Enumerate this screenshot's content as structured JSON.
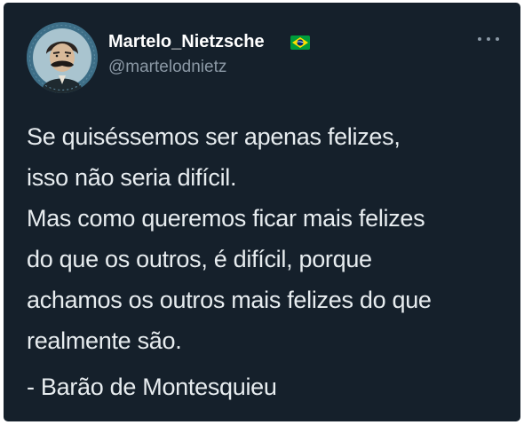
{
  "tweet": {
    "author": {
      "display_name": "Martelo_Nietzsche",
      "handle": "@martelodnietz",
      "flag": "brazil-flag",
      "avatar": "nietzsche-portrait"
    },
    "more_icon": "more-options-icon",
    "text_lines": [
      "Se quiséssemos ser apenas felizes,",
      "isso não seria difícil.",
      "Mas como queremos ficar mais felizes",
      "do que os outros, é difícil, porque",
      "achamos os outros mais felizes do que",
      "realmente são."
    ],
    "attribution": "- Barão de Montesquieu"
  },
  "colors": {
    "card_background": "#15202b",
    "primary_text": "#e7ecef",
    "secondary_text": "#8b98a5",
    "flag_green": "#009c3b",
    "flag_yellow": "#ffdf00",
    "flag_blue": "#002776"
  }
}
